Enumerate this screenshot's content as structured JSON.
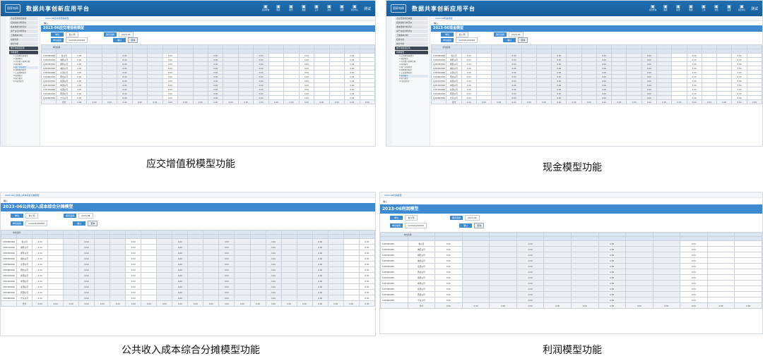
{
  "app": {
    "title": "数据共享创新应用平台",
    "logo_text": "国家电网",
    "user": "测试",
    "header_icons": [
      {
        "icon": "chart-icon",
        "label": "应用查询"
      },
      {
        "icon": "report-icon",
        "label": "报表"
      },
      {
        "icon": "model-icon",
        "label": "模型"
      },
      {
        "icon": "grid-icon",
        "label": "数据"
      },
      {
        "icon": "tool-icon",
        "label": "工具"
      },
      {
        "icon": "doc-icon",
        "label": "文档"
      },
      {
        "icon": "gear-icon",
        "label": "设置"
      },
      {
        "icon": "bell-icon",
        "label": "消息中心"
      }
    ]
  },
  "captions": {
    "vat": "应交增值税模型功能",
    "cash": "现金模型功能",
    "cost": "公共收入成本综合分摊模型功能",
    "profit": "利润模型功能"
  },
  "panels": {
    "vat": {
      "title": "2023-06应交增值税模型",
      "form": {
        "org_label": "单位",
        "org_value": "省公司",
        "period_label": "期间选择",
        "period_value": "2023-06",
        "code_label": "单位编码",
        "code_value": "1AX021202000",
        "confirm_label": "确认",
        "confirm_button": "查询"
      },
      "sidebar": [
        "企业经营综合看板",
        "经营指标分析评价",
        "成本费用分析评价",
        "资产负债分析评价",
        "工程成本分析",
        "投资分析",
        "综合分析",
        "数字化模型应用",
        "智能报告"
      ],
      "submenu": [
        "1.应交增值税模型",
        "2.现金模型",
        "3.公共收入成本分摊",
        "4.利润模型",
        "5.资产负债模型",
        "6.成本费用模型",
        "7.工程成本模型",
        "8.投资模型",
        "9.综合模型",
        "10.报告模型"
      ],
      "active_sub": 4
    },
    "cash": {
      "title": "2023-06现金模型",
      "form": {
        "org_label": "单位",
        "org_value": "省公司",
        "period_label": "期间选择",
        "period_value": "2023-06",
        "code_label": "单位编码",
        "code_value": "1AX021202000",
        "confirm_label": "确认",
        "confirm_button": "查询"
      },
      "sidebar": [
        "企业经营综合看板",
        "经营指标分析评价",
        "成本费用分析评价",
        "资产负债分析评价",
        "工程成本分析",
        "投资分析",
        "综合分析",
        "数字化模型应用",
        "智能报告"
      ],
      "submenu": [
        "1.应交增值税模型",
        "2.现金模型",
        "3.公共收入成本分摊",
        "4.利润模型",
        "5.资产负债模型",
        "6.成本费用模型",
        "7.工程成本模型",
        "8.投资模型",
        "9.综合模型",
        "10.报告模型"
      ],
      "active_sub": 7
    },
    "cost": {
      "title": "2023-06公共收入成本综合分摊模型",
      "form": {
        "org_label": "单位",
        "org_value": "省公司",
        "period_label": "期间选择",
        "period_value": "2023-06",
        "code_label": "单位编码",
        "code_value": "1AX021202000",
        "confirm_label": "确认",
        "confirm_button": "查询"
      }
    },
    "profit": {
      "title": "2023-06利润模型",
      "form": {
        "org_label": "单位",
        "org_value": "省公司",
        "period_label": "期间选择",
        "period_value": "2023-06",
        "code_label": "单位编码",
        "code_value": "1AX021202000",
        "confirm_label": "确认",
        "confirm_button": "查询"
      }
    }
  },
  "table": {
    "org_header": "单位名称",
    "codes": [
      "1030000000",
      "1030700000",
      "1030300000",
      "1030400000",
      "1030500000",
      "1030600000",
      "1031100000",
      "1031200000",
      "1031300000",
      "1031400000",
      "1032600000"
    ],
    "names": [
      "省公司",
      "城区公司",
      "郊区公司",
      "城北公司",
      "东部公司",
      "西北公司",
      "南部公司",
      "中部公司",
      "北部公司",
      "西部公司",
      "宁东公司"
    ],
    "total_label": "合计",
    "zero": "0.00"
  }
}
